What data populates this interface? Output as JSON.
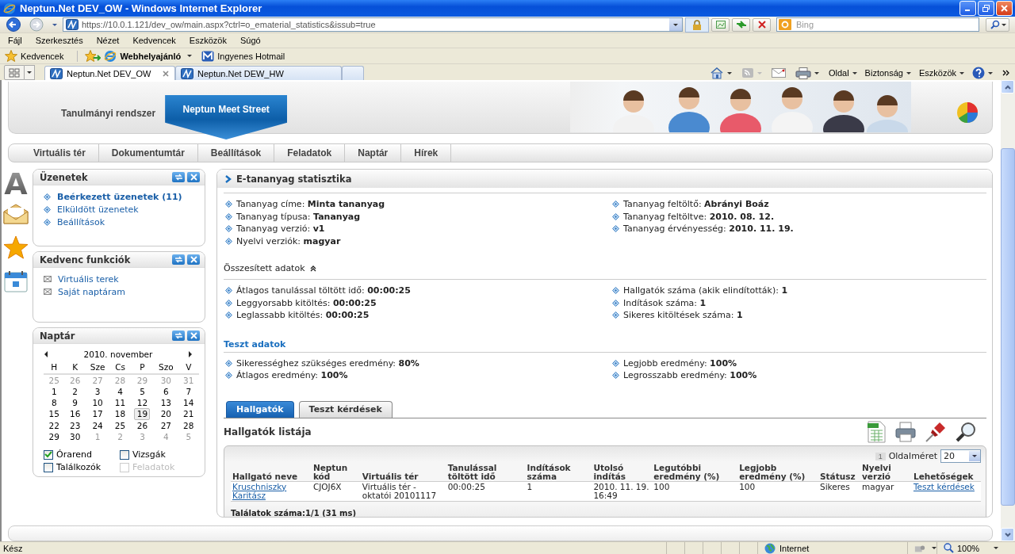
{
  "window": {
    "title": "Neptun.Net DEV_OW - Windows Internet Explorer"
  },
  "address_bar": {
    "url": "https://10.0.1.121/dev_ow/main.aspx?ctrl=o_ematerial_statistics&issub=true"
  },
  "search": {
    "placeholder": "Bing"
  },
  "menu": [
    "Fájl",
    "Szerkesztés",
    "Nézet",
    "Kedvencek",
    "Eszközök",
    "Súgó"
  ],
  "favorites_bar": {
    "label": "Kedvencek",
    "links": [
      {
        "label": "Webhelyajánló",
        "kind": "dropdown"
      },
      {
        "label": "Ingyenes Hotmail",
        "kind": "link"
      }
    ]
  },
  "browser_tabs": [
    {
      "label": "Neptun.Net DEV_OW",
      "selected": true
    },
    {
      "label": "Neptun.Net DEW_HW",
      "selected": false
    }
  ],
  "command_bar": [
    "Oldal",
    "Biztonság",
    "Eszközök"
  ],
  "systems": [
    {
      "label": "Tanulmányi rendszer",
      "selected": false
    },
    {
      "label": "Neptun Meet Street",
      "selected": true
    }
  ],
  "nav": [
    "Virtuális tér",
    "Dokumentumtár",
    "Beállítások",
    "Feladatok",
    "Naptár",
    "Hírek"
  ],
  "sidebar_letter": "A",
  "messages": {
    "title": "Üzenetek",
    "items": [
      {
        "label": "Beérkezett üzenetek (11)",
        "unread": true
      },
      {
        "label": "Elküldött üzenetek",
        "unread": false
      },
      {
        "label": "Beállítások",
        "unread": false
      }
    ]
  },
  "favorite_functions": {
    "title": "Kedvenc funkciók",
    "items": [
      "Virtuális terek",
      "Saját naptáram"
    ]
  },
  "calendar": {
    "title": "Naptár",
    "month": "2010. november",
    "weekdays": [
      "H",
      "K",
      "Sze",
      "Cs",
      "P",
      "Szo",
      "V"
    ],
    "weeks": [
      [
        {
          "day": "25",
          "outside": true,
          "selected": false
        },
        {
          "day": "26",
          "outside": true,
          "selected": false
        },
        {
          "day": "27",
          "outside": true,
          "selected": false
        },
        {
          "day": "28",
          "outside": true,
          "selected": false
        },
        {
          "day": "29",
          "outside": true,
          "selected": false
        },
        {
          "day": "30",
          "outside": true,
          "selected": false
        },
        {
          "day": "31",
          "outside": true,
          "selected": false
        }
      ],
      [
        {
          "day": "1",
          "outside": false,
          "selected": false
        },
        {
          "day": "2",
          "outside": false,
          "selected": false
        },
        {
          "day": "3",
          "outside": false,
          "selected": false
        },
        {
          "day": "4",
          "outside": false,
          "selected": false
        },
        {
          "day": "5",
          "outside": false,
          "selected": false
        },
        {
          "day": "6",
          "outside": false,
          "selected": false
        },
        {
          "day": "7",
          "outside": false,
          "selected": false
        }
      ],
      [
        {
          "day": "8",
          "outside": false,
          "selected": false
        },
        {
          "day": "9",
          "outside": false,
          "selected": false
        },
        {
          "day": "10",
          "outside": false,
          "selected": false
        },
        {
          "day": "11",
          "outside": false,
          "selected": false
        },
        {
          "day": "12",
          "outside": false,
          "selected": false
        },
        {
          "day": "13",
          "outside": false,
          "selected": false
        },
        {
          "day": "14",
          "outside": false,
          "selected": false
        }
      ],
      [
        {
          "day": "15",
          "outside": false,
          "selected": false
        },
        {
          "day": "16",
          "outside": false,
          "selected": false
        },
        {
          "day": "17",
          "outside": false,
          "selected": false
        },
        {
          "day": "18",
          "outside": false,
          "selected": false
        },
        {
          "day": "19",
          "outside": false,
          "selected": true
        },
        {
          "day": "20",
          "outside": false,
          "selected": false
        },
        {
          "day": "21",
          "outside": false,
          "selected": false
        }
      ],
      [
        {
          "day": "22",
          "outside": false,
          "selected": false
        },
        {
          "day": "23",
          "outside": false,
          "selected": false
        },
        {
          "day": "24",
          "outside": false,
          "selected": false
        },
        {
          "day": "25",
          "outside": false,
          "selected": false
        },
        {
          "day": "26",
          "outside": false,
          "selected": false
        },
        {
          "day": "27",
          "outside": false,
          "selected": false
        },
        {
          "day": "28",
          "outside": false,
          "selected": false
        }
      ],
      [
        {
          "day": "29",
          "outside": false,
          "selected": false
        },
        {
          "day": "30",
          "outside": false,
          "selected": false
        },
        {
          "day": "1",
          "outside": true,
          "selected": false
        },
        {
          "day": "2",
          "outside": true,
          "selected": false
        },
        {
          "day": "3",
          "outside": true,
          "selected": false
        },
        {
          "day": "4",
          "outside": true,
          "selected": false
        },
        {
          "day": "5",
          "outside": true,
          "selected": false
        }
      ]
    ],
    "filters": [
      {
        "label": "Órarend",
        "checked": true,
        "disabled": false
      },
      {
        "label": "Vizsgák",
        "checked": false,
        "disabled": false
      },
      {
        "label": "Találkozók",
        "checked": false,
        "disabled": false
      },
      {
        "label": "Feladatok",
        "checked": false,
        "disabled": true
      }
    ]
  },
  "statistics": {
    "title": "E-tananyag statisztika",
    "material_left": [
      {
        "label": "Tananyag címe:",
        "value": "Minta tananyag"
      },
      {
        "label": "Tananyag típusa:",
        "value": "Tananyag"
      },
      {
        "label": "Tananyag verzió:",
        "value": "v1"
      },
      {
        "label": "Nyelvi verziók:",
        "value": "magyar"
      }
    ],
    "material_right": [
      {
        "label": "Tananyag feltöltő:",
        "value": "Abrányi Boáz"
      },
      {
        "label": "Tananyag feltöltve:",
        "value": "2010. 08. 12."
      },
      {
        "label": "Tananyag érvényesség:",
        "value": "2010. 11. 19."
      }
    ],
    "summary": {
      "title": "Összesített adatok",
      "expanded": true,
      "left": [
        {
          "label": "Átlagos tanulással töltött idő:",
          "value": "00:00:25"
        },
        {
          "label": "Leggyorsabb kitöltés:",
          "value": "00:00:25"
        },
        {
          "label": "Leglassabb kitöltés:",
          "value": "00:00:25"
        }
      ],
      "right": [
        {
          "label": "Hallgatók száma (akik elindították):",
          "value": "1"
        },
        {
          "label": "Indítások száma:",
          "value": "1"
        },
        {
          "label": "Sikeres kitöltések száma:",
          "value": "1"
        }
      ]
    },
    "test": {
      "title": "Teszt adatok",
      "left": [
        {
          "label": "Sikerességhez szükséges eredmény:",
          "value": "80%"
        },
        {
          "label": "Átlagos eredmény:",
          "value": "100%"
        }
      ],
      "right": [
        {
          "label": "Legjobb eredmény:",
          "value": "100%"
        },
        {
          "label": "Legrosszabb eredmény:",
          "value": "100%"
        }
      ]
    }
  },
  "tabs": [
    {
      "label": "Hallgatók",
      "selected": true
    },
    {
      "label": "Teszt kérdések",
      "selected": false
    }
  ],
  "list": {
    "title": "Hallgatók listája",
    "page": "1",
    "page_size_label": "Oldalméret",
    "page_size": "20",
    "columns": [
      "Hallgató neve",
      "Neptun kód",
      "Virtuális tér",
      "Tanulással töltött idő",
      "Indítások száma",
      "Utolsó indítás",
      "Legutóbbi eredmény (%)",
      "Legjobb eredmény (%)",
      "Státusz",
      "Nyelvi verzió",
      "Lehetőségek"
    ],
    "rows": [
      [
        {
          "text": "Kruschniszky Karitász",
          "kind": "link"
        },
        {
          "text": "CJOJ6X",
          "kind": "text"
        },
        {
          "text": "Virtuális tér - oktatói 20101117",
          "kind": "text"
        },
        {
          "text": "00:00:25",
          "kind": "text"
        },
        {
          "text": "1",
          "kind": "text"
        },
        {
          "text": "2010. 11. 19. 16:49",
          "kind": "text"
        },
        {
          "text": "100",
          "kind": "text"
        },
        {
          "text": "100",
          "kind": "text"
        },
        {
          "text": "Sikeres",
          "kind": "text"
        },
        {
          "text": "magyar",
          "kind": "text"
        },
        {
          "text": "Teszt kérdések",
          "kind": "link"
        }
      ]
    ],
    "footer": "Találatok száma:1/1 (31 ms)"
  },
  "status_bar": {
    "text": "Kész",
    "zone": "Internet",
    "zoom": "100%"
  }
}
